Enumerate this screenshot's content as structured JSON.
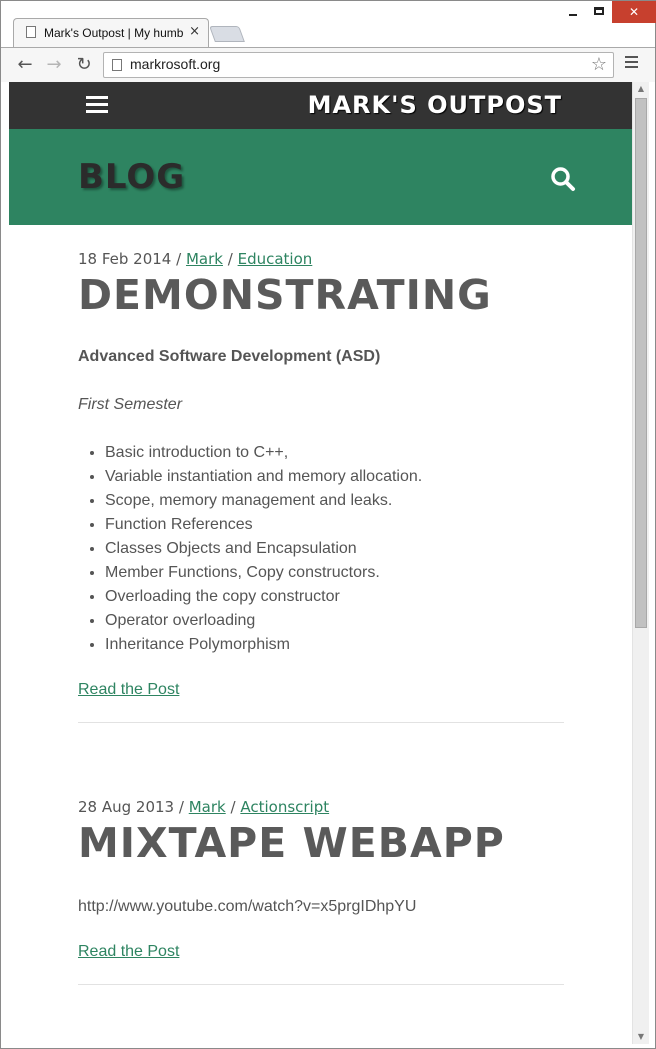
{
  "browser": {
    "tab_title": "Mark's Outpost | My humble",
    "tab_close": "×",
    "url": "markrosoft.org",
    "window_close": "✕",
    "nav_back": "←",
    "nav_forward": "→",
    "nav_reload": "↻",
    "star": "☆"
  },
  "site": {
    "title": "MARK'S OUTPOST",
    "section": "BLOG",
    "accent_color": "#2e8461",
    "header_color": "#333333"
  },
  "posts": [
    {
      "date": "18 Feb 2014",
      "author": "Mark",
      "category": "Education",
      "title": "DEMONSTRATING",
      "subtitle": "Advanced Software Development (ASD)",
      "semester": "First Semester",
      "items": [
        "Basic introduction to C++,",
        "Variable instantiation and memory allocation.",
        "Scope, memory management and leaks.",
        "Function References",
        "Classes Objects and Encapsulation",
        "Member Functions, Copy constructors.",
        "Overloading the copy constructor",
        "Operator overloading",
        "Inheritance Polymorphism"
      ],
      "read_more": "Read the Post"
    },
    {
      "date": "28 Aug 2013",
      "author": "Mark",
      "category": "Actionscript",
      "title": "MIXTAPE WEBAPP",
      "body": "http://www.youtube.com/watch?v=x5prgIDhpYU",
      "read_more": "Read the Post"
    }
  ],
  "meta_separator": "/"
}
